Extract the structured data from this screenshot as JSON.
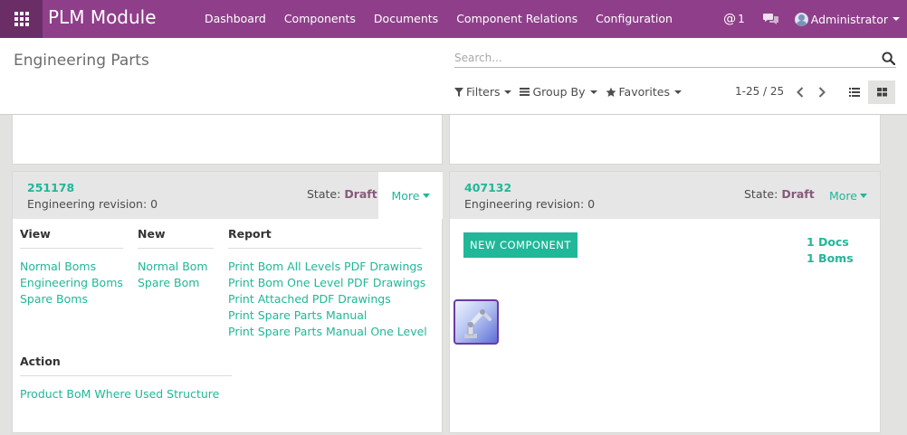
{
  "app": {
    "name": "PLM Module"
  },
  "navbar": {
    "menu": [
      "Dashboard",
      "Components",
      "Documents",
      "Component Relations",
      "Configuration"
    ],
    "mentions_count": "1",
    "user_name": "Administrator"
  },
  "control_panel": {
    "title": "Engineering Parts",
    "search_placeholder": "Search...",
    "filters_label": "Filters",
    "group_by_label": "Group By",
    "favorites_label": "Favorites",
    "pager": "1-25 / 25",
    "active_view": "kanban"
  },
  "cards": [
    {
      "code": "251178",
      "revision": "Engineering revision: 0",
      "state_label": "State:",
      "state_value": "Draft",
      "more_label": "More",
      "dropdown": {
        "view_title": "View",
        "view_links": [
          "Normal Boms",
          "Engineering Boms",
          "Spare Boms"
        ],
        "new_title": "New",
        "new_links": [
          "Normal Bom",
          "Spare Bom"
        ],
        "report_title": "Report",
        "report_links": [
          "Print Bom All Levels PDF Drawings",
          "Print Bom One Level PDF Drawings",
          "Print Attached PDF Drawings",
          "Print Spare Parts Manual",
          "Print Spare Parts Manual One Level"
        ],
        "action_title": "Action",
        "action_links": [
          "Product BoM Where Used Structure"
        ]
      }
    },
    {
      "code": "407132",
      "revision": "Engineering revision: 0",
      "state_label": "State:",
      "state_value": "Draft",
      "more_label": "More",
      "new_component_label": "NEW COMPONENT",
      "docs_label": "1 Docs",
      "boms_label": "1 Boms"
    }
  ],
  "colors": {
    "navbar": "#8f3f8a",
    "navbar_apps": "#6a2d66",
    "accent": "#21b799",
    "state": "#875a7b",
    "background": "#e2e2e0"
  }
}
